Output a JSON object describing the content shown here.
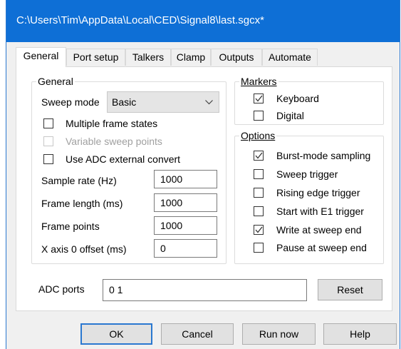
{
  "window": {
    "title": "C:\\Users\\Tim\\AppData\\Local\\CED\\Signal8\\last.sgcx*"
  },
  "tabs": [
    "General",
    "Port setup",
    "Talkers",
    "Clamp",
    "Outputs",
    "Automate"
  ],
  "active_tab": "General",
  "general": {
    "legend": "General",
    "sweep_mode_label": "Sweep mode",
    "sweep_mode_value": "Basic",
    "multiple_frame_states": {
      "label": "Multiple frame states",
      "checked": false
    },
    "variable_sweep_points": {
      "label": "Variable sweep points",
      "checked": false,
      "enabled": false
    },
    "use_adc_external_convert": {
      "label": "Use ADC external convert",
      "checked": false
    },
    "sample_rate_label": "Sample rate (Hz)",
    "sample_rate_value": "1000",
    "frame_length_label": "Frame length (ms)",
    "frame_length_value": "1000",
    "frame_points_label": "Frame points",
    "frame_points_value": "1000",
    "x_axis_offset_label": "X axis 0 offset (ms)",
    "x_axis_offset_value": "0"
  },
  "markers": {
    "legend": "Markers",
    "keyboard": {
      "label": "Keyboard",
      "checked": true
    },
    "digital": {
      "label": "Digital",
      "checked": false
    }
  },
  "options": {
    "legend": "Options",
    "burst_mode_sampling": {
      "label": "Burst-mode sampling",
      "checked": true
    },
    "sweep_trigger": {
      "label": "Sweep trigger",
      "checked": false
    },
    "rising_edge_trigger": {
      "label": "Rising edge trigger",
      "checked": false
    },
    "start_with_e1_trigger": {
      "label": "Start with E1 trigger",
      "checked": false
    },
    "write_at_sweep_end": {
      "label": "Write at sweep end",
      "checked": true
    },
    "pause_at_sweep_end": {
      "label": "Pause at sweep end",
      "checked": false
    }
  },
  "adc_ports": {
    "label": "ADC ports",
    "value": "0 1",
    "reset_label": "Reset"
  },
  "buttons": {
    "ok": "OK",
    "cancel": "Cancel",
    "run_now": "Run now",
    "help": "Help"
  },
  "colors": {
    "titlebar": "#0e6fd6",
    "default_button_border": "#2a78d0",
    "window_bg": "#f0f0f0"
  }
}
